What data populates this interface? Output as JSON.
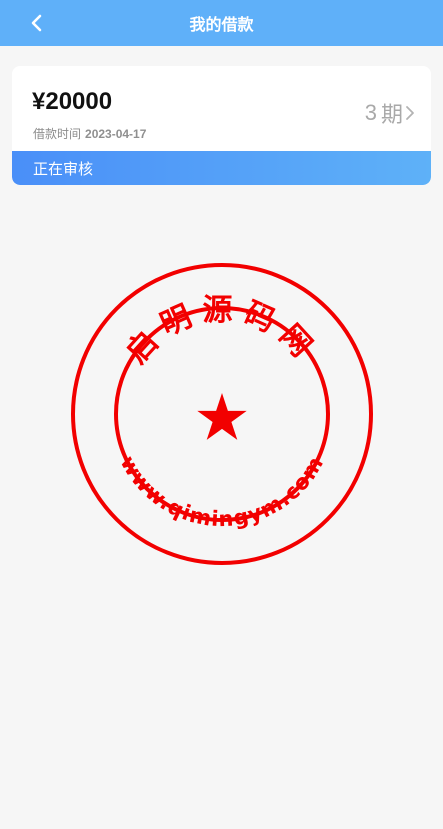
{
  "header": {
    "title": "我的借款",
    "back_icon": "chevron-left-icon"
  },
  "loan": {
    "amount": "¥20000",
    "date_label": "借款时间",
    "date_value": "2023-04-17",
    "periods_number": "3",
    "periods_unit": "期",
    "status": "正在审核"
  },
  "watermark": {
    "top_text": "启明源码网",
    "bottom_text": "www.qimingym.com",
    "color": "#f20000"
  },
  "colors": {
    "header_bg": "#5fb0f9",
    "status_gradient_start": "#4a8ff8",
    "status_gradient_end": "#5eb1f8",
    "page_bg": "#f6f6f6"
  }
}
